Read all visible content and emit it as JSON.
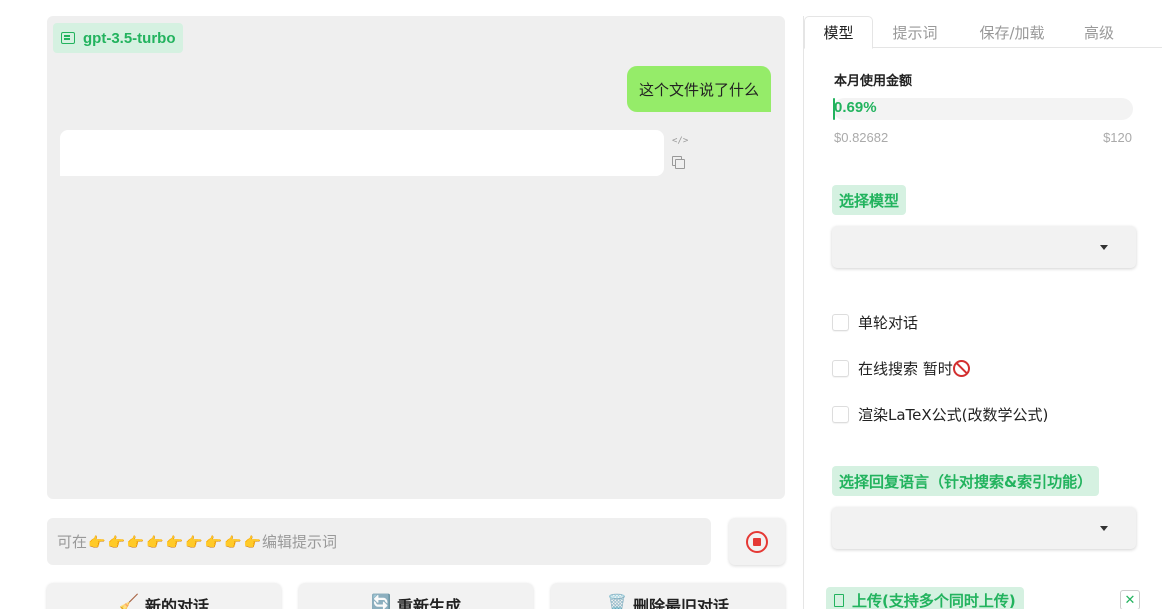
{
  "chat": {
    "model_name": "gpt-3.5-turbo",
    "messages": [
      {
        "role": "user",
        "text": "这个文件说了什么"
      },
      {
        "role": "assistant",
        "text": ""
      }
    ],
    "code_icon_glyph": "</>"
  },
  "input": {
    "placeholder_prefix": "可在",
    "placeholder_suffix": "编辑提示词",
    "hand_count": 9,
    "hand_glyph": "👉"
  },
  "buttons": {
    "new_chat": {
      "icon": "🧹",
      "label": "新的对话"
    },
    "regenerate": {
      "icon": "🔄",
      "label": "重新生成"
    },
    "delete_last": {
      "icon": "🗑️",
      "label": "删除最旧对话"
    }
  },
  "tabs": [
    "模型",
    "提示词",
    "保存/加载",
    "高级"
  ],
  "active_tab": 0,
  "usage": {
    "title": "本月使用金额",
    "percent_label": "0.69%",
    "percent": 0.69,
    "used": "$0.82682",
    "limit": "$120"
  },
  "model_select": {
    "label": "选择模型",
    "value": ""
  },
  "options": [
    {
      "label": "单轮对话",
      "checked": false
    },
    {
      "label": "在线搜索 暂时",
      "checked": false,
      "icon": "no-entry-icon"
    },
    {
      "label": "渲染LaTeX公式(改数学公式)",
      "checked": false
    }
  ],
  "language_select": {
    "label": "选择回复语言（针对搜索&索引功能）",
    "value": ""
  },
  "upload": {
    "label": "上传(支持多个同时上传)",
    "close_glyph": "✕"
  },
  "colors": {
    "accent": "#22b35e",
    "chip_bg": "#d5f1e1",
    "user_bubble": "#95ec69",
    "chat_bg": "#efefef",
    "stop_red": "#e53935"
  }
}
